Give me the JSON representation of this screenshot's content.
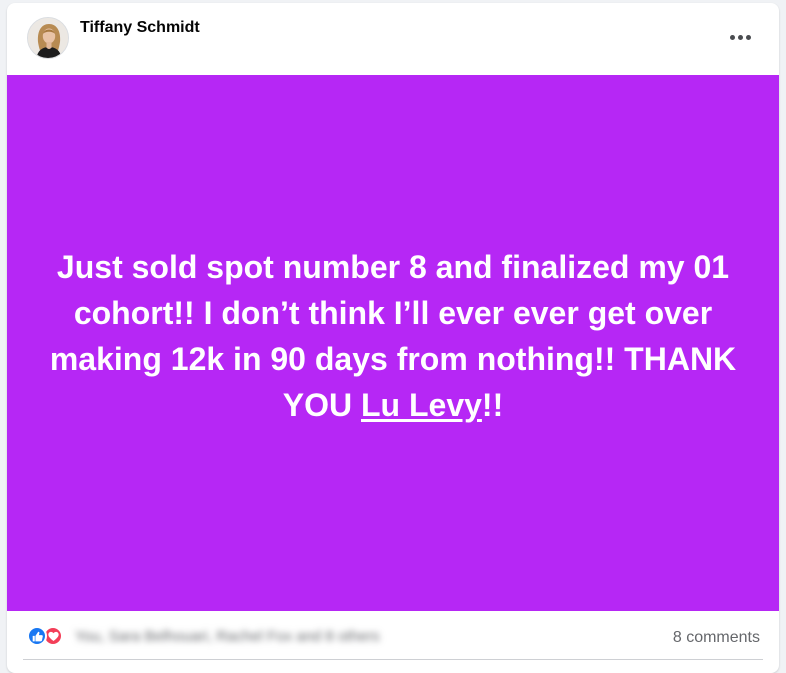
{
  "post": {
    "author": "Tiffany Schmidt",
    "avatar_icon": "profile-photo",
    "more_icon": "more-horizontal-icon",
    "background_color": "#b627f5",
    "text_before_mention": "Just sold spot number 8 and finalized my 01 cohort!! I don’t think I’ll ever ever get over making 12k in 90 days from nothing!! THANK YOU ",
    "mention": "Lu Levy",
    "text_after_mention": "!!"
  },
  "footer": {
    "reaction_icons": [
      "like-icon",
      "love-icon"
    ],
    "reaction_names": "You, Sara Belhouari, Rachel Fox and 8 others",
    "comments": "8 comments"
  },
  "colors": {
    "like": "#1877f2",
    "love": "#f33e58",
    "secondary_text": "#65676b"
  }
}
